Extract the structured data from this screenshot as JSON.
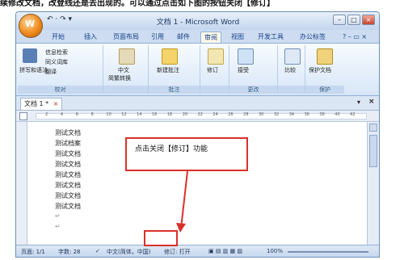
{
  "caption": "续修改文档，改登线还是去出现的。可以通过点击如下图的按钮关闭【修订】",
  "window": {
    "title": "文档 1 - Microsoft Word",
    "office_button_label": "W",
    "qat": "↶ · ↷ ▾",
    "controls": {
      "minimize": "–",
      "maximize": "□",
      "close": "×"
    }
  },
  "ribbon_tabs": [
    "开始",
    "插入",
    "页面布局",
    "引用",
    "邮件",
    "审阅",
    "视图",
    "开发工具",
    "办公标签"
  ],
  "active_tab_index": 5,
  "ribbon_right": "? – ▭ ×",
  "groups": {
    "proofing": {
      "label": "校对",
      "items": [
        "拼写和语法",
        "信息检索",
        "同义词库",
        "翻译"
      ]
    },
    "chinese": {
      "label": "",
      "items": [
        "中文",
        "简繁转换"
      ]
    },
    "comments": {
      "label": "批注",
      "items": [
        "新建批注"
      ]
    },
    "tracking": {
      "label": "",
      "items": [
        "修订"
      ]
    },
    "changes": {
      "label": "更改",
      "items": [
        "接受"
      ]
    },
    "compare": {
      "label": "",
      "items": [
        "比较"
      ]
    },
    "protect": {
      "label": "保护",
      "items": [
        "保护文档"
      ]
    }
  },
  "document_tab": {
    "label": "文档 1 *",
    "close": "×"
  },
  "ruler_marks": [
    "2",
    "4",
    "6",
    "8",
    "10",
    "12",
    "14",
    "16",
    "18",
    "20",
    "22",
    "24",
    "26",
    "28",
    "30",
    "32",
    "34",
    "36",
    "38",
    "40",
    "42"
  ],
  "document_lines": [
    "测试文档",
    "测试档案",
    "测试文档",
    "测试文档",
    "测试文档",
    "测试文档",
    "测试文档",
    "测试文档",
    "↵",
    "↵"
  ],
  "callout_text": "点击关闭【修订】功能",
  "status_bar": {
    "page": "页面: 1/1",
    "words": "字数: 28",
    "language": "中文(简体，中国)",
    "track_changes": "修订: 打开",
    "zoom": "100%"
  },
  "colors": {
    "accent_red": "#d9302a",
    "ribbon_blue": "#cddcf0",
    "title_text": "#1f3a63"
  }
}
